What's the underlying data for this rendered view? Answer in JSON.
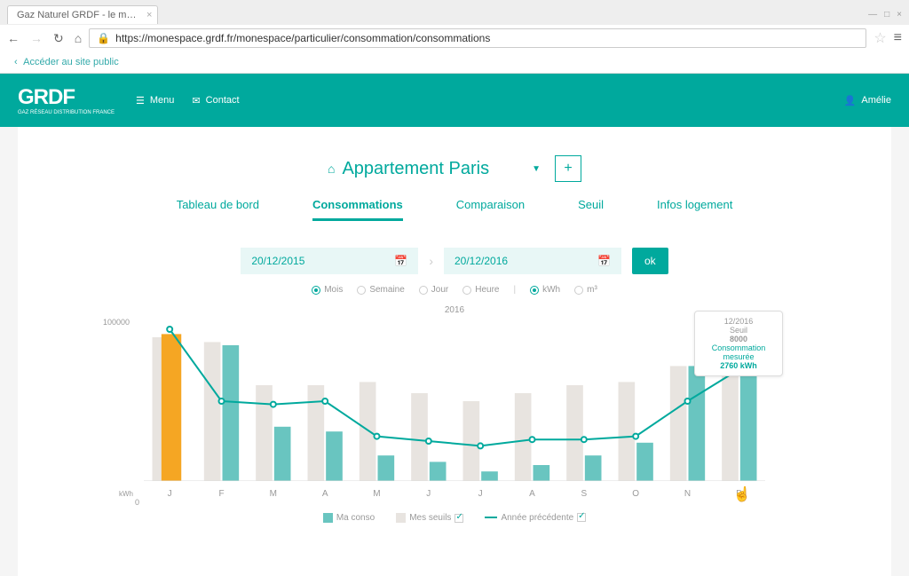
{
  "browser": {
    "tab_title": "Gaz Naturel GRDF - le m…",
    "url": "https://monespace.grdf.fr/monespace/particulier/consommation/consommations"
  },
  "public_link": "Accéder au site public",
  "header": {
    "logo": "GRDF",
    "logo_sub": "GAZ RÉSEAU DISTRIBUTION FRANCE",
    "menu": "Menu",
    "contact": "Contact",
    "user": "Amélie"
  },
  "location": {
    "name": "Appartement Paris"
  },
  "tabs": [
    {
      "label": "Tableau de bord",
      "active": false
    },
    {
      "label": "Consommations",
      "active": true
    },
    {
      "label": "Comparaison",
      "active": false
    },
    {
      "label": "Seuil",
      "active": false
    },
    {
      "label": "Infos logement",
      "active": false
    }
  ],
  "date_range": {
    "start": "20/12/2015",
    "end": "20/12/2016",
    "ok": "ok"
  },
  "granularity": {
    "time": [
      "Mois",
      "Semaine",
      "Jour",
      "Heure"
    ],
    "time_selected": "Mois",
    "unit": [
      "kWh",
      "m³"
    ],
    "unit_selected": "kWh"
  },
  "chart_data": {
    "type": "bar",
    "title": "2016",
    "categories": [
      "J",
      "F",
      "M",
      "A",
      "M",
      "J",
      "J",
      "A",
      "S",
      "O",
      "N",
      "D"
    ],
    "ylabel": "kWh",
    "ylim": [
      0,
      100000
    ],
    "series": [
      {
        "name": "Ma conso",
        "color": "#69c5c0",
        "values": [
          null,
          85000,
          34000,
          31000,
          16000,
          12000,
          6000,
          10000,
          16000,
          24000,
          72000,
          80000
        ]
      },
      {
        "name": "Mes seuils",
        "color": "#e8e4e0",
        "values": [
          90000,
          87000,
          60000,
          60000,
          62000,
          55000,
          50000,
          55000,
          60000,
          62000,
          72000,
          80000
        ]
      },
      {
        "name": "Année précédente",
        "type": "line",
        "color": "#00a99d",
        "values": [
          95000,
          50000,
          48000,
          50000,
          28000,
          25000,
          22000,
          26000,
          26000,
          28000,
          50000,
          70000
        ]
      }
    ],
    "highlight": {
      "index": 0,
      "color": "#f5a623",
      "value": 92000
    },
    "legend": [
      "Ma conso",
      "Mes seuils",
      "Année précédente"
    ]
  },
  "tooltip": {
    "period": "12/2016",
    "seuil_label": "Seuil",
    "seuil_value": "8000",
    "conso_label": "Consommation mesurée",
    "conso_value": "2760 kWh"
  }
}
